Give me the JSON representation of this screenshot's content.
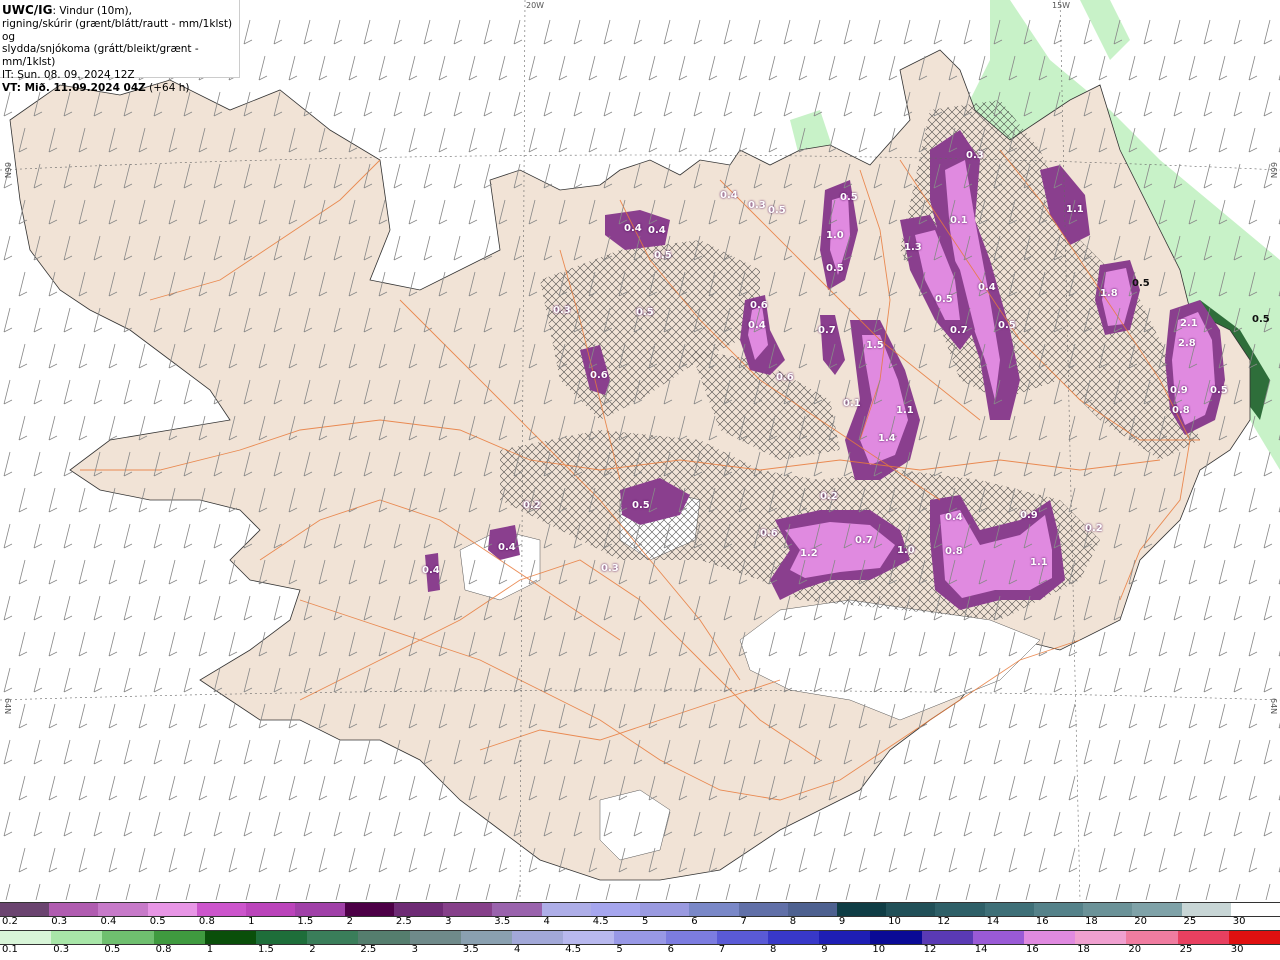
{
  "header": {
    "title": "UWC/IG",
    "title_rest": ": Vindur (10m),",
    "line2": "rigning/skúrir (grænt/blátt/rautt - mm/1klst) og",
    "line3": "slydda/snjókoma (grátt/bleikt/grænt - mm/1klst)",
    "it": "IT: Sun. 08. 09. 2024 12Z",
    "vt": "VT: Mið. 11.09.2024 04Z",
    "vt_lead": "(+64 h)"
  },
  "graticule": {
    "lon_labels": [
      "20W",
      "15W"
    ],
    "lat_labels": [
      "66N",
      "66N",
      "64N",
      "64N"
    ]
  },
  "map_values": [
    "0.3",
    "0.5",
    "0.4",
    "0.3",
    "0.5",
    "0.4",
    "0.4",
    "0.5",
    "0.6",
    "0.5",
    "1.0",
    "0.1",
    "1.3",
    "0.4",
    "0.5",
    "0.7",
    "0.5",
    "1.1",
    "1.8",
    "0.5",
    "0.5",
    "2.1",
    "2.8",
    "0.9",
    "0.8",
    "0.5",
    "0.4",
    "0.6",
    "0.3",
    "0.1",
    "0.7",
    "1.5",
    "0.6",
    "1.1",
    "1.4",
    "0.2",
    "0.6",
    "0.5",
    "0.3",
    "0.4",
    "0.2",
    "1.2",
    "0.7",
    "1.0",
    "0.4",
    "0.9",
    "0.8",
    "1.1",
    "0.2",
    "0.4",
    "0.5"
  ],
  "legend_snow": {
    "labels": [
      "0.2",
      "0.3",
      "0.4",
      "0.5",
      "0.8",
      "1",
      "1.5",
      "2",
      "2.5",
      "3",
      "3.5",
      "4",
      "4.5",
      "5",
      "6",
      "7",
      "8",
      "9",
      "10",
      "12",
      "14",
      "16",
      "18",
      "20",
      "25",
      "30"
    ],
    "colors": [
      "#6b4470",
      "#b05cb0",
      "#c77ac9",
      "#e896e6",
      "#cc55cc",
      "#bb44bb",
      "#a040a8",
      "#4d0047",
      "#6e2b75",
      "#86408a",
      "#9a63ad",
      "#aeaee8",
      "#a6a6ee",
      "#9a9ae0",
      "#7a88c8",
      "#6170a8",
      "#4e6190",
      "#0f3d45",
      "#215058",
      "#2f6068",
      "#3f7078",
      "#55828a",
      "#6b9298",
      "#7fa2a8",
      "#c8d6d6",
      "#ffffff"
    ]
  },
  "legend_rain": {
    "labels": [
      "0.1",
      "0.3",
      "0.5",
      "0.8",
      "1",
      "1.5",
      "2",
      "2.5",
      "3",
      "3.5",
      "4",
      "4.5",
      "5",
      "6",
      "7",
      "8",
      "9",
      "10",
      "12",
      "14",
      "16",
      "18",
      "20",
      "25",
      "30"
    ],
    "colors": [
      "#d8f5d8",
      "#a8e6a8",
      "#6fbf6f",
      "#3f9a3f",
      "#0a4f0a",
      "#1e6e3a",
      "#3a7e5a",
      "#557e6e",
      "#6f8a8a",
      "#8aa0b0",
      "#a2a8d8",
      "#b8b8ee",
      "#9898e6",
      "#7c7ce0",
      "#5a5ad6",
      "#3838c8",
      "#1e1eb4",
      "#0a0a96",
      "#5a3ab4",
      "#9a5ad6",
      "#e08ae0",
      "#f0a0d0",
      "#f07ca0",
      "#e84060",
      "#e01010"
    ]
  }
}
